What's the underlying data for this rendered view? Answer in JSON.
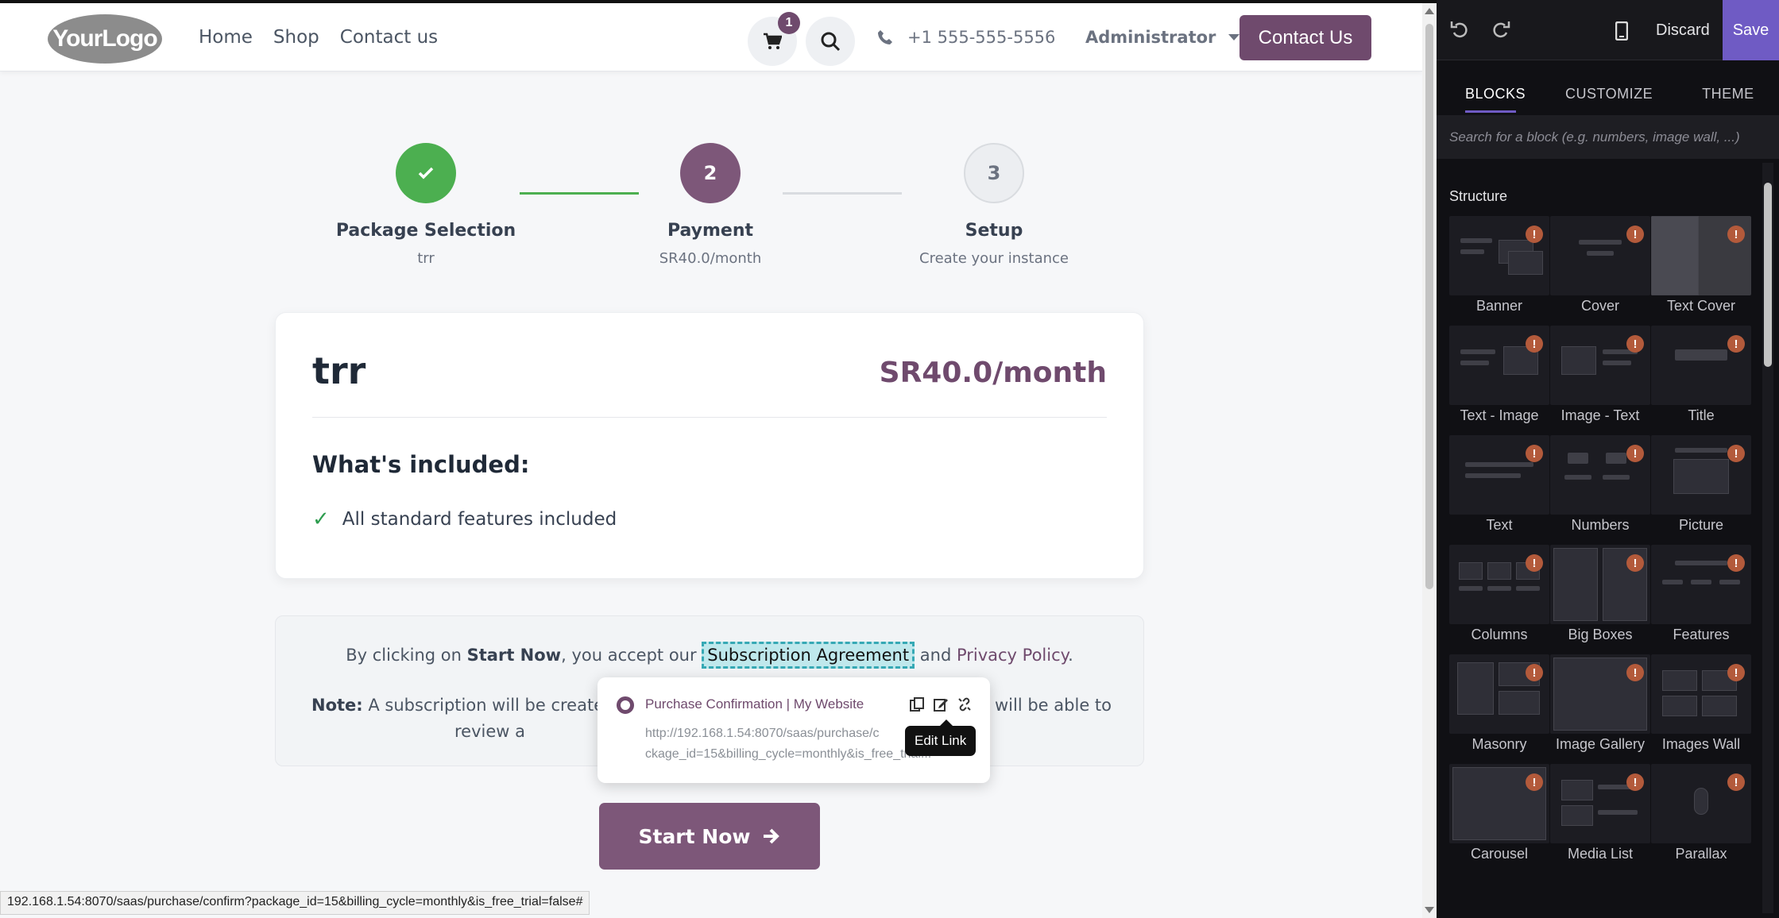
{
  "navbar": {
    "logo_text": "YourLogo",
    "links": [
      "Home",
      "Shop",
      "Contact us"
    ],
    "cart_count": "1",
    "phone": "+1 555-555-5556",
    "user": "Administrator",
    "contact_button": "Contact Us"
  },
  "stepper": {
    "steps": [
      {
        "number": "✓",
        "title": "Package Selection",
        "subtitle": "trr",
        "state": "completed"
      },
      {
        "number": "2",
        "title": "Payment",
        "subtitle": "SR40.0/month",
        "state": "active"
      },
      {
        "number": "3",
        "title": "Setup",
        "subtitle": "Create your instance",
        "state": "pending"
      }
    ]
  },
  "package": {
    "name": "trr",
    "price": "SR40.0/month",
    "included_title": "What's included:",
    "features": [
      "All standard features included"
    ]
  },
  "terms": {
    "prefix": "By clicking on ",
    "start_now": "Start Now",
    "middle": ", you accept our ",
    "subscription_link": "Subscription Agreement",
    "and": " and ",
    "privacy_link": "Privacy Policy",
    "end": ".",
    "note_label": "Note:",
    "note_left": "A subscription will be created a",
    "note_right": "u will be able to",
    "note_line2": "review a"
  },
  "link_popover": {
    "title": "Purchase Confirmation | My Website",
    "url": "http://192.168.1.54:8070/saas/purchase/confirm?package_id=15&billing_cycle=monthly&is_free_trial=false#",
    "url_line1": "http://192.168.1.54:8070/saas/purchase/c",
    "url_line2": "ckage_id=15&billing_cycle=monthly&is_free_trial...",
    "tooltip": "Edit Link"
  },
  "start_button": "Start Now",
  "status_bar_url": "192.168.1.54:8070/saas/purchase/confirm?package_id=15&billing_cycle=monthly&is_free_trial=false#",
  "editor": {
    "discard": "Discard",
    "save": "Save",
    "tabs": [
      "BLOCKS",
      "CUSTOMIZE",
      "THEME"
    ],
    "active_tab": "BLOCKS",
    "search_placeholder": "Search for a block (e.g. numbers, image wall, ...)",
    "section_title": "Structure",
    "blocks": [
      "Banner",
      "Cover",
      "Text Cover",
      "Text - Image",
      "Image - Text",
      "Title",
      "Text",
      "Numbers",
      "Picture",
      "Columns",
      "Big Boxes",
      "Features",
      "Masonry",
      "Image Gallery",
      "Images Wall",
      "Carousel",
      "Media List",
      "Parallax"
    ]
  },
  "colors": {
    "brand": "#6f4a6d",
    "success": "#4caf50",
    "editor_accent": "#6f5bc4",
    "warning_badge": "#b35a3b"
  }
}
